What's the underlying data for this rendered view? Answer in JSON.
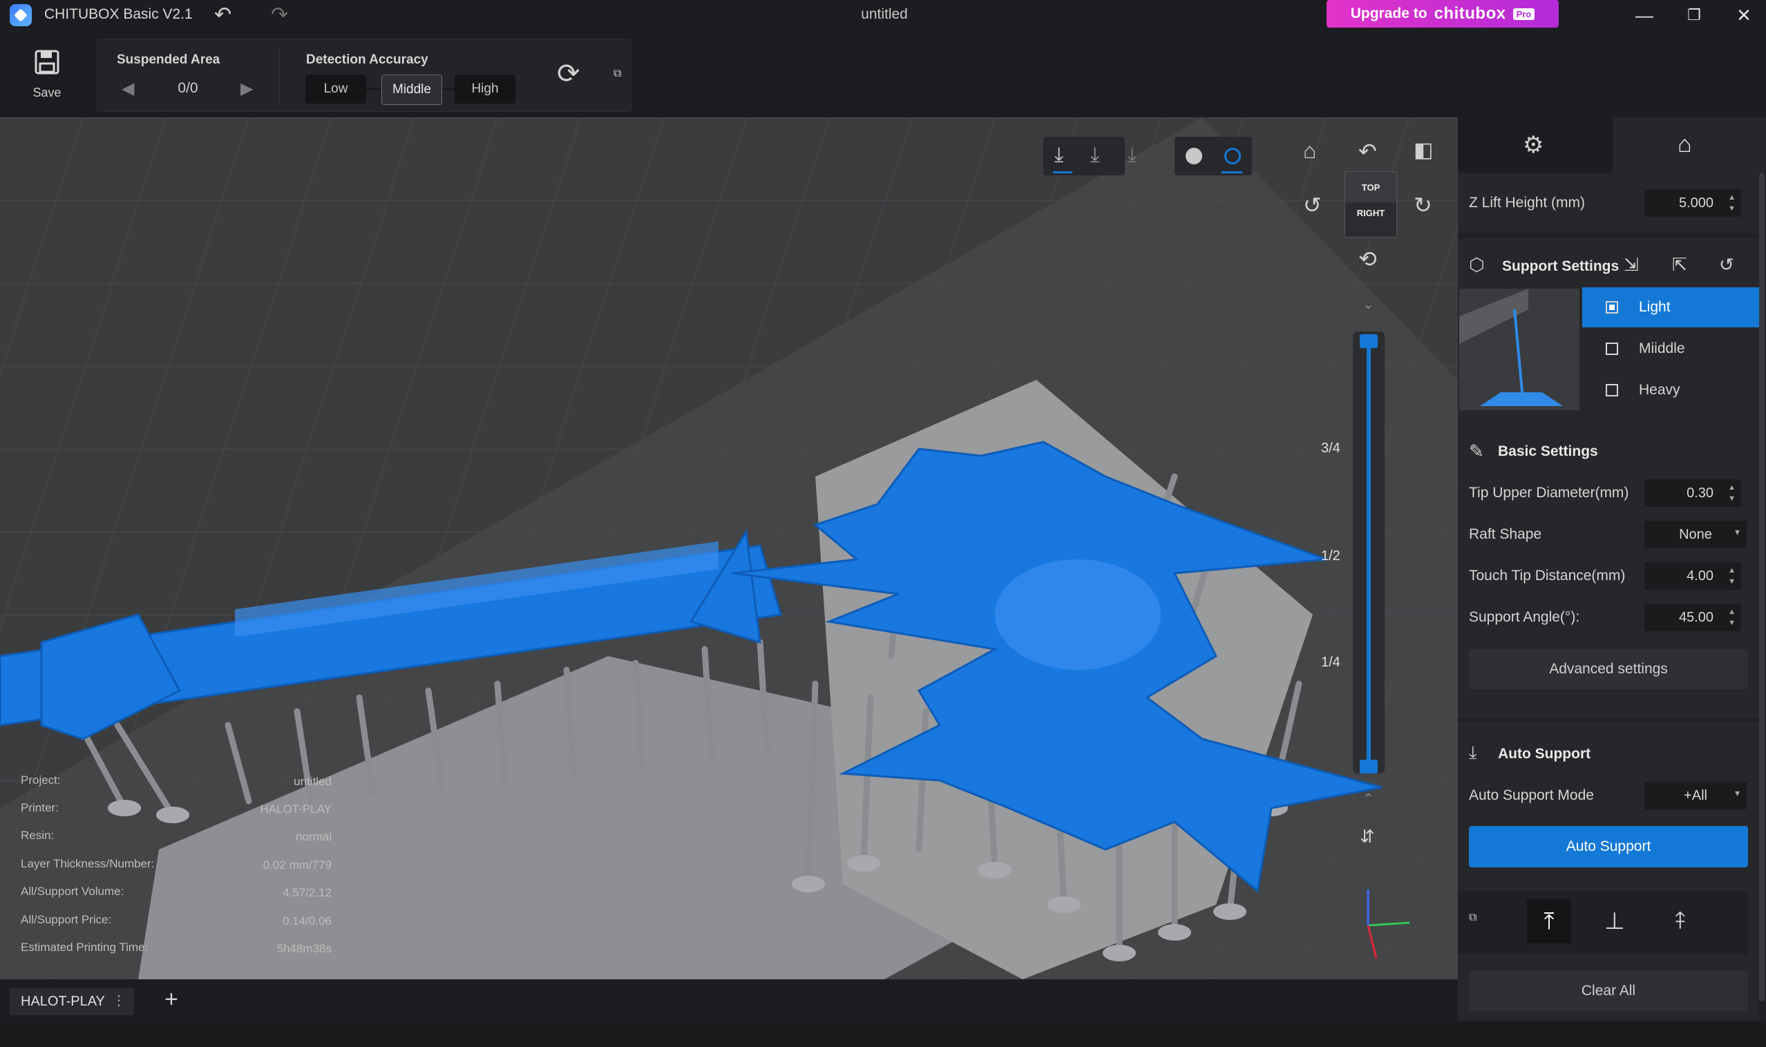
{
  "app": {
    "title": "CHITUBOX Basic V2.1",
    "document_title": "untitled"
  },
  "upgrade": {
    "prefix": "Upgrade to",
    "brand": "chitubox",
    "badge": "Pro"
  },
  "toolbar": {
    "save_label": "Save",
    "suspended_area": {
      "label": "Suspended Area",
      "value": "0/0"
    },
    "detection_accuracy": {
      "label": "Detection Accuracy",
      "options": [
        "Low",
        "Middle",
        "High"
      ],
      "selected": "Middle"
    }
  },
  "view_cube": {
    "top": "TOP",
    "right": "RIGHT"
  },
  "slider_marks": [
    "3/4",
    "1/2",
    "1/4"
  ],
  "info": [
    {
      "key": "Project:",
      "value": "untitled"
    },
    {
      "key": "Printer:",
      "value": "HALOT-PLAY"
    },
    {
      "key": "Resin:",
      "value": "normal"
    },
    {
      "key": "Layer Thickness/Number:",
      "value": "0.02 mm/779"
    },
    {
      "key": "All/Support Volume:",
      "value": "4.57/2.12"
    },
    {
      "key": "All/Support Price:",
      "value": "0.14/0.06"
    },
    {
      "key": "Estimated Printing Time:",
      "value": "5h48m38s"
    }
  ],
  "printer_tab": {
    "label": "HALOT-PLAY"
  },
  "right_panel": {
    "z_lift": {
      "label": "Z Lift Height (mm)",
      "value": "5.000"
    },
    "support_settings": {
      "title": "Support Settings",
      "options": [
        "Light",
        "Miiddle",
        "Heavy"
      ],
      "selected": "Light"
    },
    "basic_settings": {
      "title": "Basic Settings",
      "tip_upper_diameter": {
        "label": "Tip Upper Diameter(mm)",
        "value": "0.30"
      },
      "raft_shape": {
        "label": "Raft Shape",
        "value": "None"
      },
      "touch_tip_distance": {
        "label": "Touch Tip Distance(mm)",
        "value": "4.00"
      },
      "support_angle": {
        "label": "Support Angle(°):",
        "value": "45.00"
      },
      "advanced_button": "Advanced settings"
    },
    "auto_support": {
      "title": "Auto Support",
      "mode_label": "Auto Support Mode",
      "mode_value": "+All",
      "button": "Auto Support",
      "clear_all": "Clear All"
    }
  },
  "colors": {
    "accent": "#1479d6",
    "model": "#1878e0",
    "upgrade": "#d634cc"
  }
}
